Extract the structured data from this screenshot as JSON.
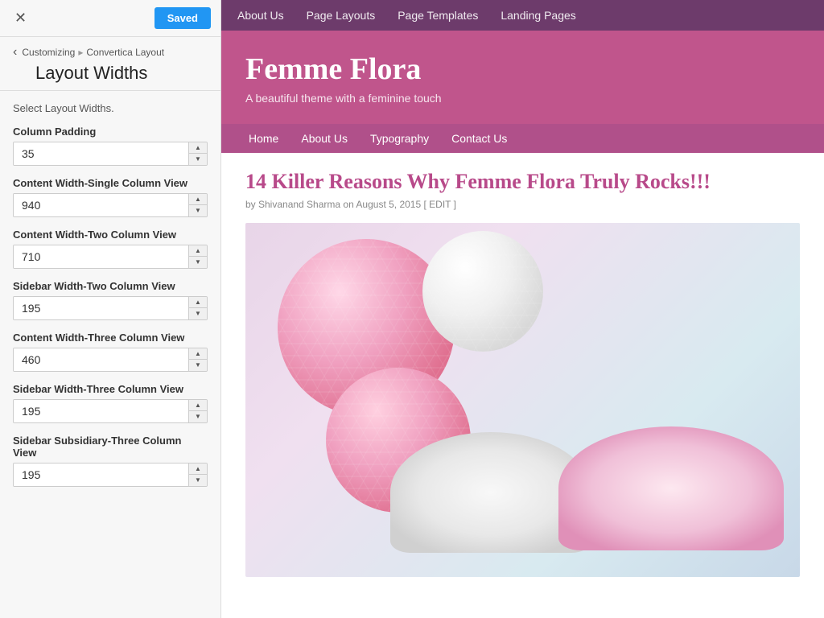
{
  "topBar": {
    "closeLabel": "✕",
    "savedLabel": "Saved"
  },
  "breadcrumb": {
    "backLabel": "‹",
    "root": "Customizing",
    "separator": "▸",
    "current": "Convertica Layout"
  },
  "panelTitle": "Layout Widths",
  "panelDescription": "Select Layout Widths.",
  "fields": [
    {
      "label": "Column Padding",
      "value": "35"
    },
    {
      "label": "Content Width-Single Column View",
      "value": "940"
    },
    {
      "label": "Content Width-Two Column View",
      "value": "710"
    },
    {
      "label": "Sidebar Width-Two Column View",
      "value": "195"
    },
    {
      "label": "Content Width-Three Column View",
      "value": "460"
    },
    {
      "label": "Sidebar Width-Three Column View",
      "value": "195"
    },
    {
      "label": "Sidebar Subsidiary-Three Column View",
      "value": "195"
    }
  ],
  "preview": {
    "topNav": {
      "links": [
        "About Us",
        "Page Layouts",
        "Page Templates",
        "Landing Pages"
      ]
    },
    "hero": {
      "title": "Femme Flora",
      "tagline": "A beautiful theme with a feminine touch"
    },
    "secondaryNav": {
      "links": [
        "Home",
        "About Us",
        "Typography",
        "Contact Us"
      ]
    },
    "post": {
      "title": "14 Killer Reasons Why Femme Flora Truly Rocks!!!",
      "meta": "by Shivanand Sharma on August 5, 2015 [ EDIT ]"
    }
  }
}
